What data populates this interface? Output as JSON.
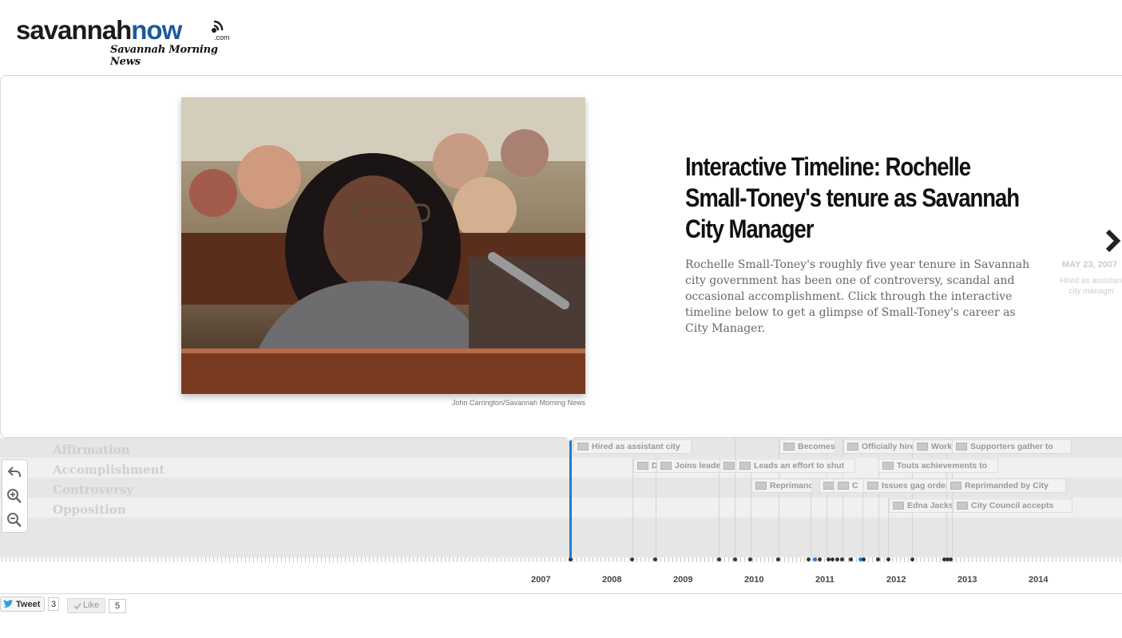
{
  "header": {
    "logo_word_a": "savannah",
    "logo_word_b": "now",
    "logo_com": ".com",
    "logo_paper": "Savannah Morning News"
  },
  "slide": {
    "photo_credit": "John Carrington/Savannah Morning News",
    "title": "Interactive Timeline: Rochelle Small-Toney's tenure as Savannah City Manager",
    "description": "Rochelle Small-Toney's roughly five year tenure in Savannah city government has been one of controversy, scandal and occasional accomplishment. Click through the interactive timeline below to get a glimpse of Small-Toney's career as City Manager.",
    "next_date": "MAY 23, 2007",
    "next_text": "Hired as assistant city manager",
    "next_icon": "chevron-right-icon"
  },
  "timeline": {
    "bands": [
      "Affirmation",
      "Accomplishment",
      "Controversy",
      "Opposition"
    ],
    "controls": [
      "back-arrow-icon",
      "zoom-in-icon",
      "zoom-out-icon"
    ],
    "flags": [
      {
        "label": "Hired as assistant city",
        "band": 0
      },
      {
        "label": "Becomes",
        "band": 0
      },
      {
        "label": "Officially hire",
        "band": 0
      },
      {
        "label": "Work",
        "band": 0
      },
      {
        "label": "Supporters gather to",
        "band": 0
      },
      {
        "label": "D",
        "band": 1
      },
      {
        "label": "Joins leader",
        "band": 1
      },
      {
        "label": "",
        "band": 1
      },
      {
        "label": "Leads an effort to shut",
        "band": 1
      },
      {
        "label": "Touts achievements to",
        "band": 1
      },
      {
        "label": "Reprimand",
        "band": 2
      },
      {
        "label": "",
        "band": 2
      },
      {
        "label": "C",
        "band": 2
      },
      {
        "label": "Issues gag order",
        "band": 2
      },
      {
        "label": "Reprimanded by City",
        "band": 2
      },
      {
        "label": "Edna Jacks",
        "band": 3
      },
      {
        "label": "City Council accepts",
        "band": 3
      }
    ],
    "years": [
      "2007",
      "2008",
      "2009",
      "2010",
      "2011",
      "2012",
      "2013",
      "2014"
    ]
  },
  "social": {
    "tweet_label": "Tweet",
    "tweet_count": "3",
    "like_label": "Like",
    "like_count": "5"
  },
  "colors": {
    "brand_blue": "#1d5a9a",
    "marker_blue": "#1c7ed6",
    "band_label": "#cfcfcf"
  }
}
